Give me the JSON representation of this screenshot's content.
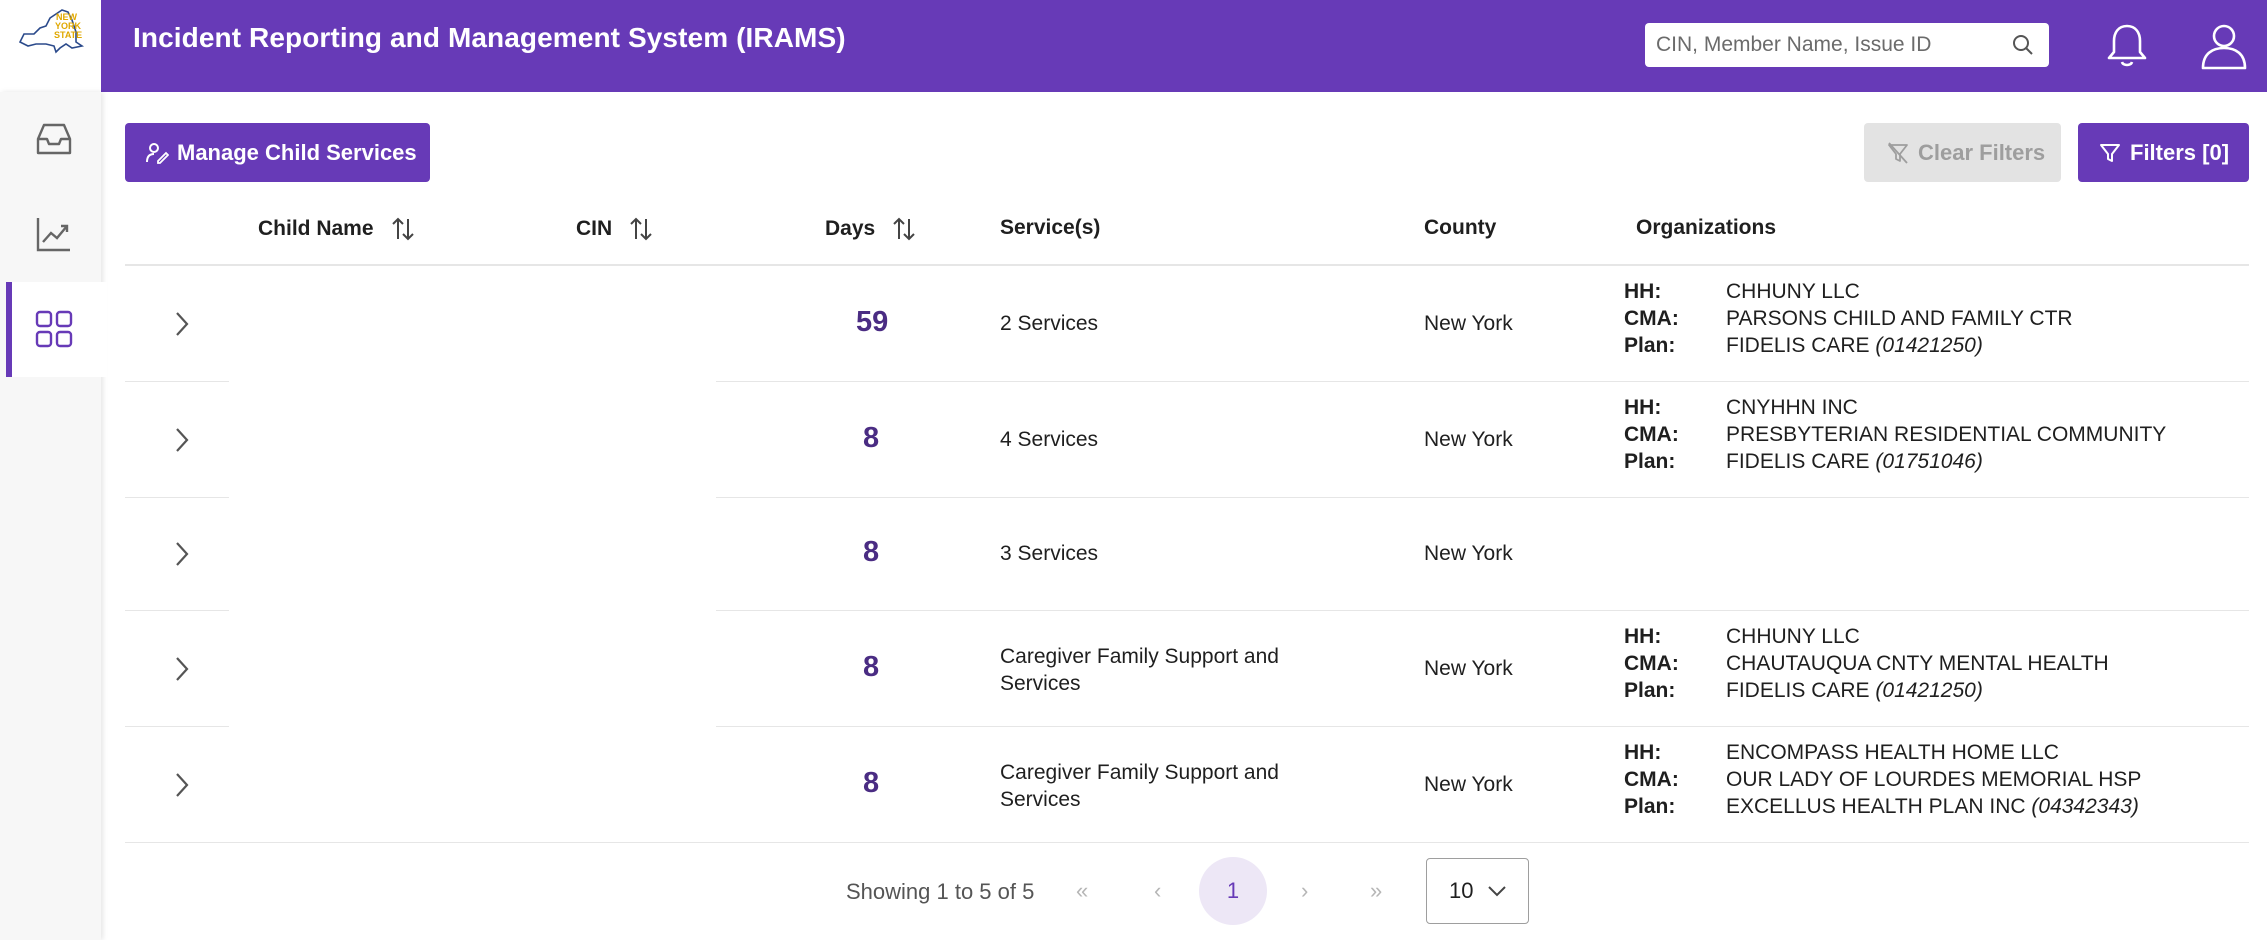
{
  "header": {
    "title": "Incident Reporting and Management System (IRAMS)",
    "logo_text": [
      "NEW",
      "YORK",
      "STATE"
    ],
    "search_placeholder": "CIN, Member Name, Issue ID",
    "brand_color": "#673ab7"
  },
  "icons": {
    "search": "search-icon",
    "notifications": "bell-icon",
    "user": "user-icon",
    "sidebar": [
      "inbox-icon",
      "chart-line-icon",
      "grid-icon"
    ]
  },
  "toolbar": {
    "manage_label": "Manage Child Services",
    "clear_filters_label": "Clear Filters",
    "filters_label": "Filters [0]"
  },
  "table": {
    "columns": {
      "child_name": "Child Name",
      "cin": "CIN",
      "days": "Days",
      "services": "Service(s)",
      "county": "County",
      "organizations": "Organizations"
    },
    "org_labels": {
      "hh": "HH:",
      "cma": "CMA:",
      "plan": "Plan:"
    },
    "rows": [
      {
        "days": "59",
        "services": "2 Services",
        "county": "New York",
        "hh": "CHHUNY LLC",
        "cma": "PARSONS CHILD AND FAMILY CTR",
        "plan": "FIDELIS CARE",
        "plan_code": "(01421250)"
      },
      {
        "days": "8",
        "services": "4 Services",
        "county": "New York",
        "hh": "CNYHHN INC",
        "cma": "PRESBYTERIAN RESIDENTIAL COMMUNITY",
        "plan": "FIDELIS CARE",
        "plan_code": "(01751046)"
      },
      {
        "days": "8",
        "services": "3 Services",
        "county": "New York",
        "hh": "",
        "cma": "",
        "plan": "",
        "plan_code": ""
      },
      {
        "days": "8",
        "services": "Caregiver Family Support and Services",
        "county": "New York",
        "hh": "CHHUNY LLC",
        "cma": "CHAUTAUQUA CNTY MENTAL HEALTH",
        "plan": "FIDELIS CARE",
        "plan_code": "(01421250)"
      },
      {
        "days": "8",
        "services": "Caregiver Family Support and Services",
        "county": "New York",
        "hh": "ENCOMPASS HEALTH HOME LLC",
        "cma": "OUR LADY OF LOURDES MEMORIAL HSP",
        "plan": "EXCELLUS HEALTH PLAN INC",
        "plan_code": "(04342343)"
      }
    ]
  },
  "pagination": {
    "showing": "Showing 1 to 5 of 5",
    "first": "«",
    "prev": "‹",
    "current_page": "1",
    "next": "›",
    "last": "»",
    "page_size": "10"
  }
}
